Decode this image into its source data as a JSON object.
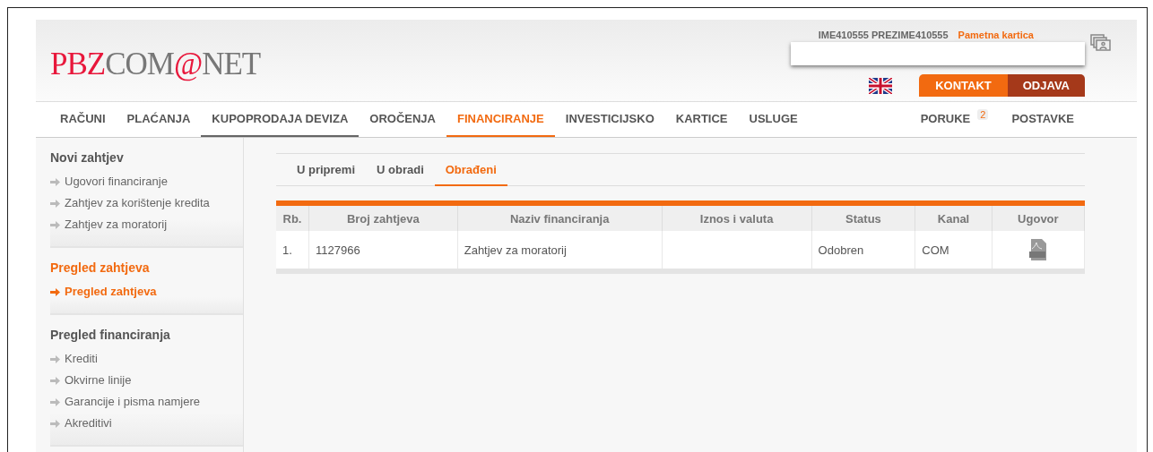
{
  "logo": {
    "part_1": "PBZ",
    "part_2": "COM",
    "part_3": "@",
    "part_4": "NET"
  },
  "user": {
    "name": "IME410555 PREZIME410555",
    "card": "Pametna kartica"
  },
  "top_buttons": [
    {
      "label": "KONTAKT",
      "kind": "primary"
    },
    {
      "label": "ODJAVA",
      "kind": "dark"
    }
  ],
  "nav": {
    "items": [
      {
        "label": "RAČUNI",
        "selected": false,
        "hovered": false
      },
      {
        "label": "PLAĆANJA",
        "selected": false,
        "hovered": false
      },
      {
        "label": "KUPOPRODAJA DEVIZA",
        "selected": false,
        "hovered": true
      },
      {
        "label": "OROČENJA",
        "selected": false,
        "hovered": false
      },
      {
        "label": "FINANCIRANJE",
        "selected": true,
        "hovered": false
      },
      {
        "label": "INVESTICIJSKO",
        "selected": false,
        "hovered": false
      },
      {
        "label": "KARTICE",
        "selected": false,
        "hovered": false
      },
      {
        "label": "USLUGE",
        "selected": false,
        "hovered": false
      }
    ],
    "right_items": [
      {
        "label": "PORUKE",
        "badge": "2"
      },
      {
        "label": "POSTAVKE"
      }
    ]
  },
  "sidebar": [
    {
      "title": "Novi zahtjev",
      "selected": false,
      "items": [
        {
          "label": "Ugovori financiranje",
          "selected": false
        },
        {
          "label": "Zahtjev za korištenje kredita",
          "selected": false
        },
        {
          "label": "Zahtjev za moratorij",
          "selected": false
        }
      ]
    },
    {
      "title": "Pregled zahtjeva",
      "selected": true,
      "items": [
        {
          "label": "Pregled zahtjeva",
          "selected": true
        }
      ]
    },
    {
      "title": "Pregled financiranja",
      "selected": false,
      "items": [
        {
          "label": "Krediti",
          "selected": false
        },
        {
          "label": "Okvirne linije",
          "selected": false
        },
        {
          "label": "Garancije i pisma namjere",
          "selected": false
        },
        {
          "label": "Akreditivi",
          "selected": false
        }
      ]
    }
  ],
  "tabs": [
    {
      "label": "U pripremi",
      "selected": false
    },
    {
      "label": "U obradi",
      "selected": false
    },
    {
      "label": "Obrađeni",
      "selected": true
    }
  ],
  "table": {
    "columns": [
      "Rb.",
      "Broj zahtjeva",
      "Naziv financiranja",
      "Iznos i valuta",
      "Status",
      "Kanal",
      "Ugovor"
    ],
    "rows": [
      {
        "rb": "1.",
        "broj": "1127966",
        "naziv": "Zahtjev za moratorij",
        "iznos": "",
        "status": "Odobren",
        "kanal": "COM",
        "has_pdf": true
      }
    ]
  }
}
